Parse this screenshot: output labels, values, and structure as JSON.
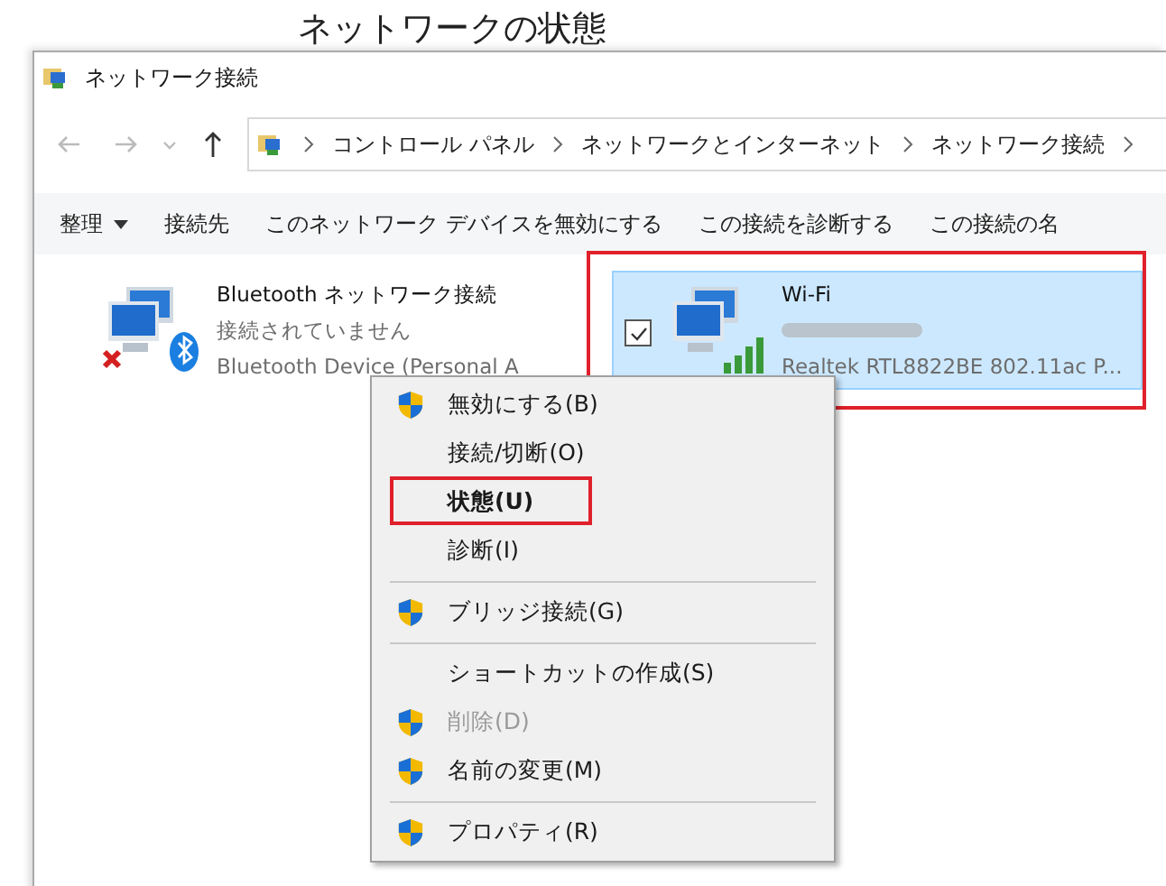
{
  "background_window": {
    "title": "ネットワークの状態"
  },
  "window": {
    "title": "ネットワーク接続"
  },
  "address_bar": {
    "path": [
      "コントロール パネル",
      "ネットワークとインターネット",
      "ネットワーク接続"
    ]
  },
  "toolbar": [
    {
      "label": "整理",
      "dropdown": true
    },
    {
      "label": "接続先",
      "dropdown": false
    },
    {
      "label": "このネットワーク デバイスを無効にする",
      "dropdown": false
    },
    {
      "label": "この接続を診断する",
      "dropdown": false
    },
    {
      "label": "この接続の名",
      "dropdown": false
    }
  ],
  "connections": [
    {
      "kind": "bluetooth",
      "name": "Bluetooth ネットワーク接続",
      "status": "接続されていません",
      "device": "Bluetooth Device (Personal A",
      "selected": false,
      "checked": false,
      "outlined": false
    },
    {
      "kind": "wifi",
      "name": "Wi-Fi",
      "status_hidden": true,
      "device": "Realtek RTL8822BE 802.11ac P...",
      "selected": true,
      "checked": true,
      "outlined": true
    }
  ],
  "context_menu": {
    "items": [
      {
        "kind": "item",
        "label": "無効にする(B)",
        "shield": true,
        "default": false,
        "disabled": false,
        "outlined": false
      },
      {
        "kind": "item",
        "label": "接続/切断(O)",
        "shield": false,
        "default": false,
        "disabled": false,
        "outlined": false
      },
      {
        "kind": "item",
        "label": "状態(U)",
        "shield": false,
        "default": true,
        "disabled": false,
        "outlined": true
      },
      {
        "kind": "item",
        "label": "診断(I)",
        "shield": false,
        "default": false,
        "disabled": false,
        "outlined": false
      },
      {
        "kind": "separator"
      },
      {
        "kind": "item",
        "label": "ブリッジ接続(G)",
        "shield": true,
        "default": false,
        "disabled": false,
        "outlined": false
      },
      {
        "kind": "separator"
      },
      {
        "kind": "item",
        "label": "ショートカットの作成(S)",
        "shield": false,
        "default": false,
        "disabled": false,
        "outlined": false
      },
      {
        "kind": "item",
        "label": "削除(D)",
        "shield": true,
        "default": false,
        "disabled": true,
        "outlined": false
      },
      {
        "kind": "item",
        "label": "名前の変更(M)",
        "shield": true,
        "default": false,
        "disabled": false,
        "outlined": false
      },
      {
        "kind": "separator"
      },
      {
        "kind": "item",
        "label": "プロパティ(R)",
        "shield": true,
        "default": false,
        "disabled": false,
        "outlined": false
      }
    ]
  }
}
